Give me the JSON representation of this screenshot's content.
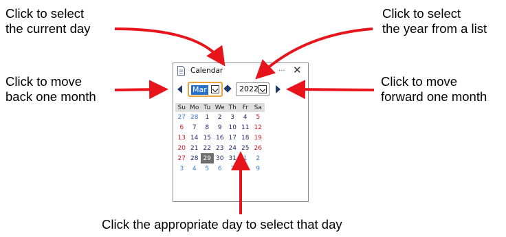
{
  "callouts": {
    "current_day": [
      "Click to select",
      "the current day"
    ],
    "year_list": [
      "Click to select",
      "the year from a list"
    ],
    "back_month": [
      "Click to move",
      "back one month"
    ],
    "forward_month": [
      "Click to move",
      "forward one month"
    ],
    "select_day": "Click the appropriate day to select that day"
  },
  "window": {
    "title": "Calendar",
    "ellipsis": "...",
    "close": "✕"
  },
  "controls": {
    "month": "Mar",
    "year": "2022"
  },
  "weekdays": [
    "Su",
    "Mo",
    "Tu",
    "We",
    "Th",
    "Fr",
    "Sa"
  ],
  "weeks": [
    [
      "27",
      "28",
      "1",
      "2",
      "3",
      "4",
      "5"
    ],
    [
      "6",
      "7",
      "8",
      "9",
      "10",
      "11",
      "12"
    ],
    [
      "13",
      "14",
      "15",
      "16",
      "17",
      "18",
      "19"
    ],
    [
      "20",
      "21",
      "22",
      "23",
      "24",
      "25",
      "26"
    ],
    [
      "27",
      "28",
      "29",
      "30",
      "31",
      "1",
      "2"
    ],
    [
      "3",
      "4",
      "5",
      "6",
      "7",
      "8",
      "9"
    ]
  ],
  "selected_day": "29",
  "colors": {
    "arrow": "#e8141c",
    "accent": "#1f3a6a",
    "selection": "#6e6e6e",
    "weekend": "#d4141c",
    "other_month": "#3a78d0",
    "month_border": "#e8a33c"
  }
}
